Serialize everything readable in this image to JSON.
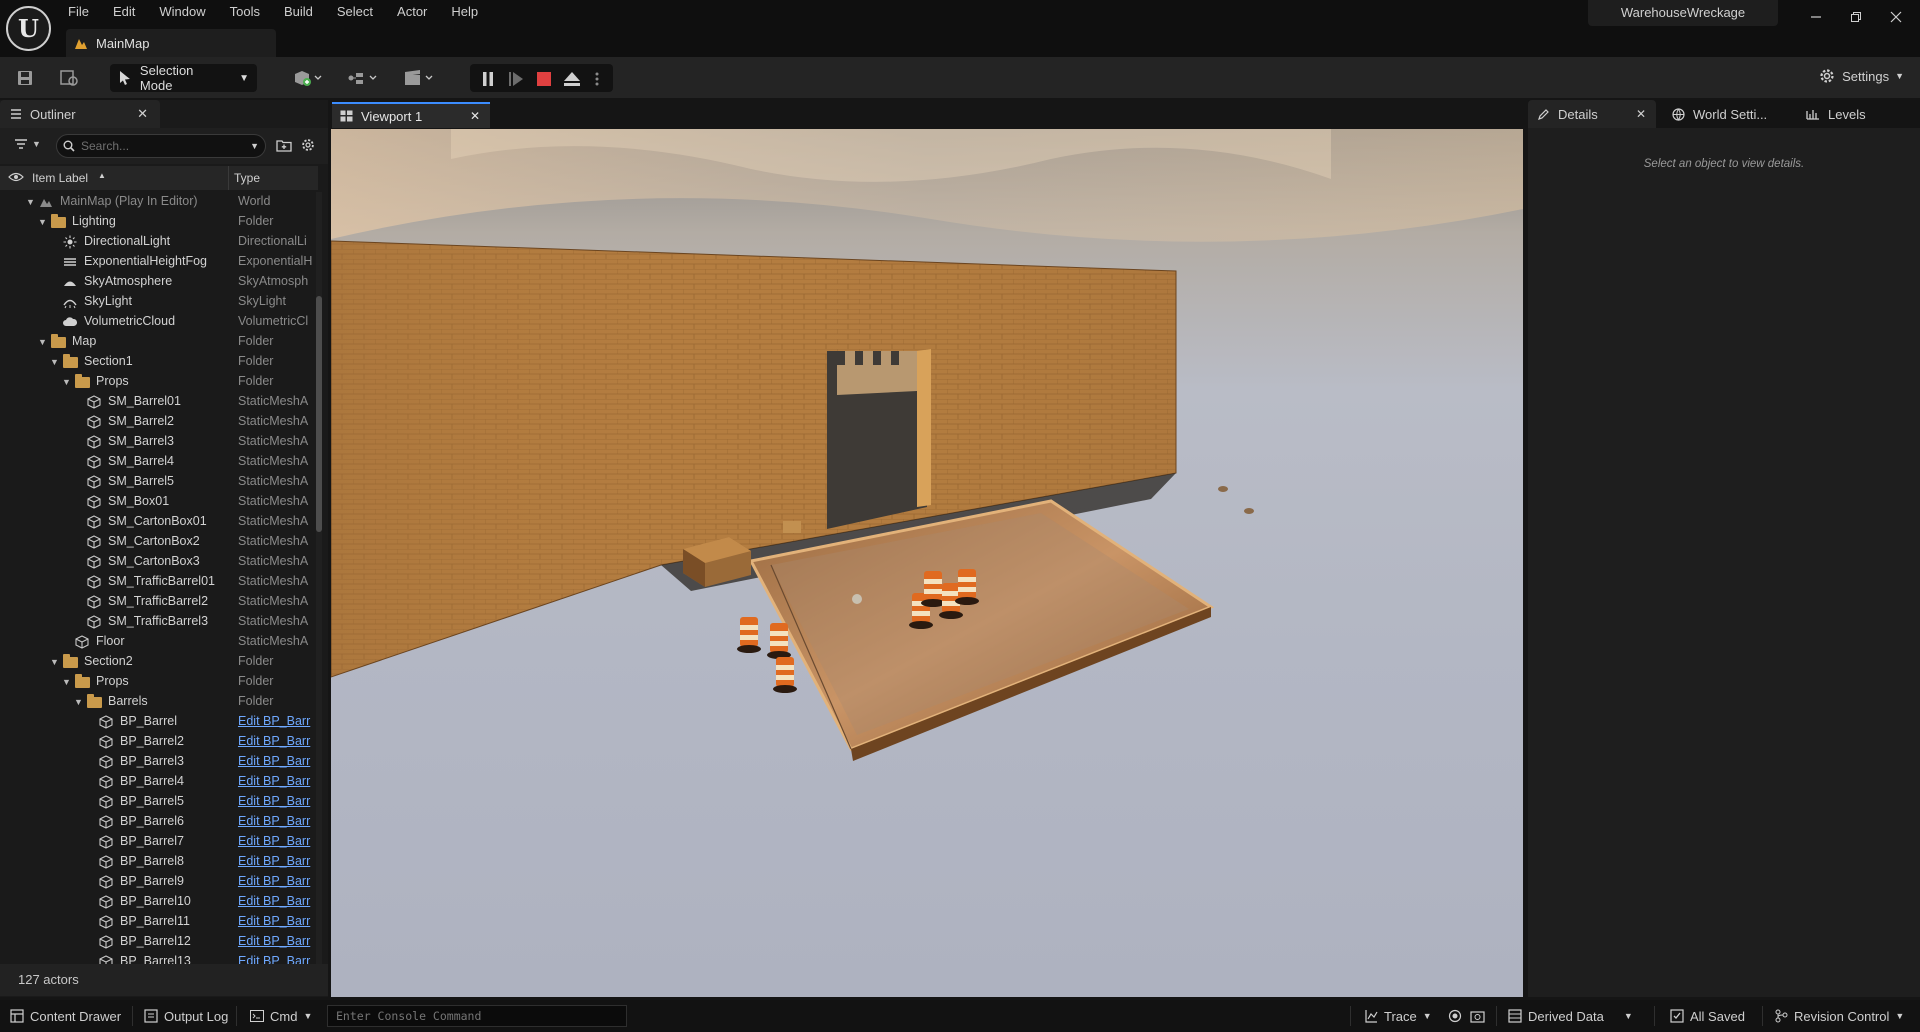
{
  "app": {
    "project_name": "WarehouseWreckage",
    "map_tab": "MainMap",
    "menu": [
      "File",
      "Edit",
      "Window",
      "Tools",
      "Build",
      "Select",
      "Actor",
      "Help"
    ]
  },
  "toolbar": {
    "selection_mode": "Selection Mode",
    "settings": "Settings"
  },
  "outliner": {
    "tab": "Outliner",
    "search_placeholder": "Search...",
    "col_label": "Item Label",
    "col_type": "Type",
    "actor_count": "127 actors",
    "rows": [
      {
        "label": "MainMap (Play In Editor)",
        "type": "World",
        "depth": 0,
        "arrow": "open",
        "icon": "map-icon",
        "dim": true
      },
      {
        "label": "Lighting",
        "type": "Folder",
        "depth": 1,
        "arrow": "open",
        "icon": "folder-icon"
      },
      {
        "label": "DirectionalLight",
        "type": "DirectionalLi",
        "depth": 2,
        "icon": "sun-icon"
      },
      {
        "label": "ExponentialHeightFog",
        "type": "ExponentialH",
        "depth": 2,
        "icon": "fog-icon"
      },
      {
        "label": "SkyAtmosphere",
        "type": "SkyAtmosph",
        "depth": 2,
        "icon": "atmosphere-icon"
      },
      {
        "label": "SkyLight",
        "type": "SkyLight",
        "depth": 2,
        "icon": "skylight-icon"
      },
      {
        "label": "VolumetricCloud",
        "type": "VolumetricCl",
        "depth": 2,
        "icon": "cloud-icon"
      },
      {
        "label": "Map",
        "type": "Folder",
        "depth": 1,
        "arrow": "open",
        "icon": "folder-icon"
      },
      {
        "label": "Section1",
        "type": "Folder",
        "depth": 2,
        "arrow": "open",
        "icon": "folder-icon"
      },
      {
        "label": "Props",
        "type": "Folder",
        "depth": 3,
        "arrow": "open",
        "icon": "folder-icon"
      },
      {
        "label": "SM_Barrel01",
        "type": "StaticMeshA",
        "depth": 4,
        "icon": "mesh-icon"
      },
      {
        "label": "SM_Barrel2",
        "type": "StaticMeshA",
        "depth": 4,
        "icon": "mesh-icon"
      },
      {
        "label": "SM_Barrel3",
        "type": "StaticMeshA",
        "depth": 4,
        "icon": "mesh-icon"
      },
      {
        "label": "SM_Barrel4",
        "type": "StaticMeshA",
        "depth": 4,
        "icon": "mesh-icon"
      },
      {
        "label": "SM_Barrel5",
        "type": "StaticMeshA",
        "depth": 4,
        "icon": "mesh-icon"
      },
      {
        "label": "SM_Box01",
        "type": "StaticMeshA",
        "depth": 4,
        "icon": "mesh-icon"
      },
      {
        "label": "SM_CartonBox01",
        "type": "StaticMeshA",
        "depth": 4,
        "icon": "mesh-icon"
      },
      {
        "label": "SM_CartonBox2",
        "type": "StaticMeshA",
        "depth": 4,
        "icon": "mesh-icon"
      },
      {
        "label": "SM_CartonBox3",
        "type": "StaticMeshA",
        "depth": 4,
        "icon": "mesh-icon"
      },
      {
        "label": "SM_TrafficBarrel01",
        "type": "StaticMeshA",
        "depth": 4,
        "icon": "mesh-icon"
      },
      {
        "label": "SM_TrafficBarrel2",
        "type": "StaticMeshA",
        "depth": 4,
        "icon": "mesh-icon"
      },
      {
        "label": "SM_TrafficBarrel3",
        "type": "StaticMeshA",
        "depth": 4,
        "icon": "mesh-icon"
      },
      {
        "label": "Floor",
        "type": "StaticMeshA",
        "depth": 3,
        "icon": "mesh-icon"
      },
      {
        "label": "Section2",
        "type": "Folder",
        "depth": 2,
        "arrow": "open",
        "icon": "folder-icon"
      },
      {
        "label": "Props",
        "type": "Folder",
        "depth": 3,
        "arrow": "open",
        "icon": "folder-icon"
      },
      {
        "label": "Barrels",
        "type": "Folder",
        "depth": 4,
        "arrow": "open",
        "icon": "folder-icon"
      },
      {
        "label": "BP_Barrel",
        "type": "Edit BP_Barr",
        "depth": 5,
        "icon": "mesh-icon",
        "link": true
      },
      {
        "label": "BP_Barrel2",
        "type": "Edit BP_Barr",
        "depth": 5,
        "icon": "mesh-icon",
        "link": true
      },
      {
        "label": "BP_Barrel3",
        "type": "Edit BP_Barr",
        "depth": 5,
        "icon": "mesh-icon",
        "link": true
      },
      {
        "label": "BP_Barrel4",
        "type": "Edit BP_Barr",
        "depth": 5,
        "icon": "mesh-icon",
        "link": true
      },
      {
        "label": "BP_Barrel5",
        "type": "Edit BP_Barr",
        "depth": 5,
        "icon": "mesh-icon",
        "link": true
      },
      {
        "label": "BP_Barrel6",
        "type": "Edit BP_Barr",
        "depth": 5,
        "icon": "mesh-icon",
        "link": true
      },
      {
        "label": "BP_Barrel7",
        "type": "Edit BP_Barr",
        "depth": 5,
        "icon": "mesh-icon",
        "link": true
      },
      {
        "label": "BP_Barrel8",
        "type": "Edit BP_Barr",
        "depth": 5,
        "icon": "mesh-icon",
        "link": true
      },
      {
        "label": "BP_Barrel9",
        "type": "Edit BP_Barr",
        "depth": 5,
        "icon": "mesh-icon",
        "link": true
      },
      {
        "label": "BP_Barrel10",
        "type": "Edit BP_Barr",
        "depth": 5,
        "icon": "mesh-icon",
        "link": true
      },
      {
        "label": "BP_Barrel11",
        "type": "Edit BP_Barr",
        "depth": 5,
        "icon": "mesh-icon",
        "link": true
      },
      {
        "label": "BP_Barrel12",
        "type": "Edit BP_Barr",
        "depth": 5,
        "icon": "mesh-icon",
        "link": true
      },
      {
        "label": "BP_Barrel13",
        "type": "Edit BP_Barr",
        "depth": 5,
        "icon": "mesh-icon",
        "link": true
      }
    ]
  },
  "viewport": {
    "tab": "Viewport 1"
  },
  "details": {
    "tabs": [
      "Details",
      "World Setti...",
      "Levels"
    ],
    "empty_message": "Select an object to view details."
  },
  "statusbar": {
    "content_drawer": "Content Drawer",
    "output_log": "Output Log",
    "cmd": "Cmd",
    "console_placeholder": "Enter Console Command",
    "trace": "Trace",
    "derived_data": "Derived Data",
    "all_saved": "All Saved",
    "revision_control": "Revision Control"
  },
  "colors": {
    "accent": "#3c8dff",
    "stop_red": "#e04040",
    "folder": "#c99a4b",
    "link": "#6ea8ff"
  }
}
